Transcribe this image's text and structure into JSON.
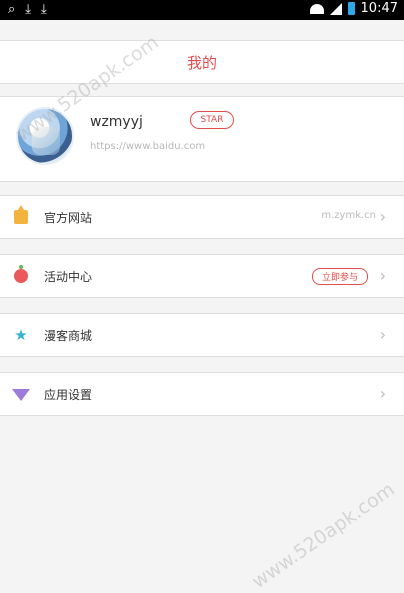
{
  "status_bar": {
    "time": "10:47"
  },
  "header": {
    "title": "我的"
  },
  "profile": {
    "username": "wzmyyj",
    "badge": "STAR",
    "url": "https://www.baidu.com"
  },
  "menu": [
    {
      "label": "官方网站",
      "value": "m.zymk.cn",
      "icon": "house-icon"
    },
    {
      "label": "活动中心",
      "action": "立即参与",
      "icon": "event-icon"
    },
    {
      "label": "漫客商城",
      "icon": "star-icon"
    },
    {
      "label": "应用设置",
      "icon": "gem-icon"
    }
  ],
  "watermark": "www.520apk.com",
  "colors": {
    "accent": "#e34c4c",
    "home_icon": "#f3b33f",
    "event_icon": "#ea5a5a",
    "star_icon": "#33b3d7",
    "gem_icon": "#9d7bd8"
  }
}
